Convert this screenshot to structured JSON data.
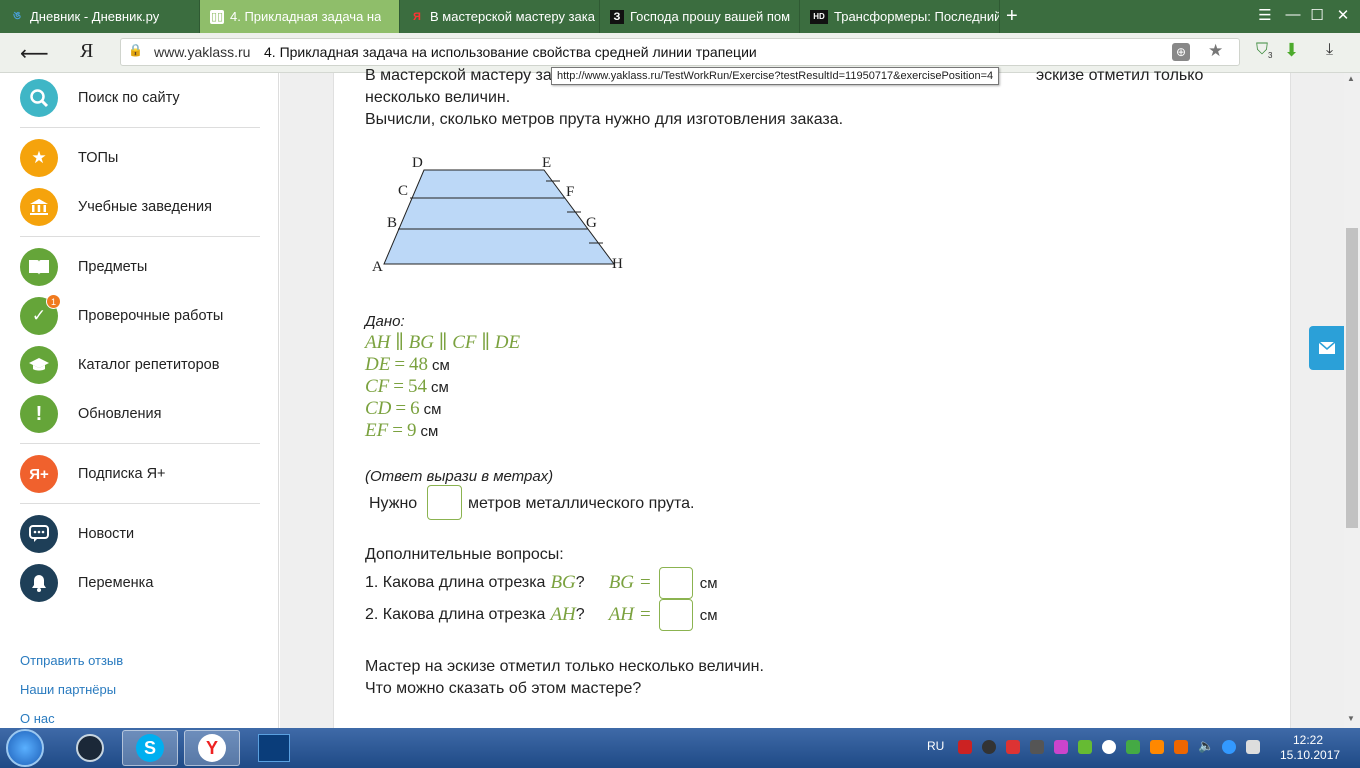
{
  "browser": {
    "tabs": [
      {
        "title": "Дневник - Дневник.ру",
        "favicon": "dnevnik-icon",
        "active": false
      },
      {
        "title": "4. Прикладная задача на",
        "favicon": "yaklass-icon",
        "active": true
      },
      {
        "title": "В мастерской мастеру зака",
        "favicon": "yandex-icon",
        "active": false
      },
      {
        "title": "Господа прошу вашей пом",
        "favicon": "znanija-icon",
        "active": false
      },
      {
        "title": "Трансформеры: Последний",
        "favicon": "hd-icon",
        "active": false
      }
    ],
    "new_tab": "+",
    "window_controls": [
      "☰",
      "—",
      "☐",
      "✕"
    ],
    "address": {
      "domain": "www.yaklass.ru",
      "title": "4. Прикладная задача на использование свойства средней линии трапеции"
    },
    "tooltip": "http://www.yaklass.ru/TestWorkRun/Exercise?testResultId=11950717&exercisePosition=4",
    "shield_count": "3"
  },
  "sidebar": {
    "items": [
      {
        "label": "Поиск по сайту",
        "icon": "search-icon",
        "color": "#3fb6c6"
      },
      {
        "label": "ТОПы",
        "icon": "star-icon",
        "color": "#f5a30c"
      },
      {
        "label": "Учебные заведения",
        "icon": "building-icon",
        "color": "#f5a30c"
      },
      {
        "label": "Предметы",
        "icon": "book-icon",
        "color": "#65a539"
      },
      {
        "label": "Проверочные работы",
        "icon": "check-icon",
        "color": "#65a539",
        "badge": "1"
      },
      {
        "label": "Каталог репетиторов",
        "icon": "graduation-cap-icon",
        "color": "#65a539"
      },
      {
        "label": "Обновления",
        "icon": "exclamation-icon",
        "color": "#65a539"
      },
      {
        "label": "Подписка Я+",
        "icon": "ya-plus-icon",
        "color": "#f0612d"
      },
      {
        "label": "Новости",
        "icon": "chat-icon",
        "color": "#1e3f58"
      },
      {
        "label": "Переменка",
        "icon": "bell-icon",
        "color": "#1e3f58"
      }
    ],
    "footer_links": [
      "Отправить отзыв",
      "Наши партнёры",
      "О нас"
    ]
  },
  "problem": {
    "intro_line1_a": "В мастерской мастеру за",
    "intro_line1_b": "эскизе отметил только",
    "intro_line2": "несколько величин.",
    "task": "Вычисли, сколько метров прута нужно для изготовления заказа.",
    "figure_labels": {
      "A": "A",
      "B": "B",
      "C": "C",
      "D": "D",
      "E": "E",
      "F": "F",
      "G": "G",
      "H": "H"
    },
    "given_title": "Дано:",
    "parallel": "AH ∥ BG ∥ CF ∥ DE",
    "given": [
      {
        "name": "DE",
        "value": "48",
        "unit": "см"
      },
      {
        "name": "CF",
        "value": "54",
        "unit": "см"
      },
      {
        "name": "CD",
        "value": "6",
        "unit": "см"
      },
      {
        "name": "EF",
        "value": "9",
        "unit": "см"
      }
    ],
    "eq": "=",
    "answer_hint": "(Ответ вырази в метрах)",
    "answer_prefix": "Нужно",
    "answer_suffix": "метров металлического прута.",
    "extra_title": "Дополнительные вопросы:",
    "extra": [
      {
        "question": "1. Какова длина отрезка",
        "segment": "BG",
        "qmark": "?",
        "unit": "см"
      },
      {
        "question": "2. Какова длина отрезка",
        "segment": "AH",
        "qmark": "?",
        "unit": "см"
      }
    ],
    "final_line1": "Мастер на эскизе отметил только несколько величин.",
    "final_line2": "Что можно сказать об этом мастере?"
  },
  "taskbar": {
    "lang": "RU",
    "time": "12:22",
    "date": "15.10.2017"
  },
  "colors": {
    "tab_bar": "#3b6d3f",
    "active_tab": "#8fbe6a",
    "math_green": "#7ba23f",
    "trapezoid_fill": "#bcd8f7"
  }
}
